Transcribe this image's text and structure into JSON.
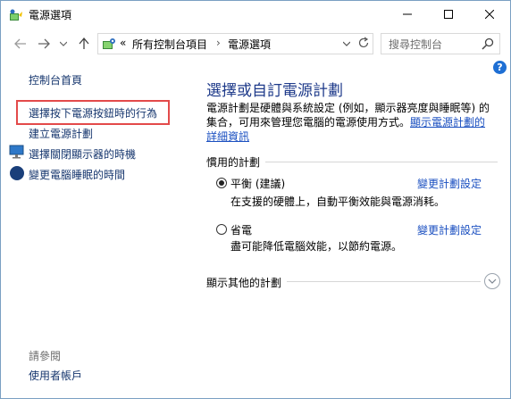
{
  "window": {
    "title": "電源選項",
    "minimize": "—",
    "maximize": "☐",
    "close": "✕"
  },
  "address": {
    "chevron": "«",
    "crumb1": "所有控制台項目",
    "sep": "›",
    "crumb2": "電源選項",
    "search_placeholder": "搜尋控制台"
  },
  "help": "?",
  "sidebar": {
    "items": [
      {
        "label": "控制台首頁"
      },
      {
        "label": "選擇按下電源按鈕時的行為"
      },
      {
        "label": "建立電源計劃"
      },
      {
        "label": "選擇關閉顯示器的時機"
      },
      {
        "label": "變更電腦睡眠的時間"
      }
    ],
    "see_also": "請參閱",
    "user_accounts": "使用者帳戶"
  },
  "main": {
    "heading": "選擇或自訂電源計劃",
    "description": "電源計劃是硬體與系統設定 (例如，顯示器亮度與睡眠等) 的集合，可用來管理您電腦的電源使用方式。",
    "more_link": "顯示電源計劃的詳細資訊",
    "preferred_section": "慣用的計劃",
    "plans": [
      {
        "name": "平衡 (建議)",
        "desc": "在支援的硬體上，自動平衡效能與電源消耗。",
        "change": "變更計劃設定",
        "selected": true
      },
      {
        "name": "省電",
        "desc": "盡可能降低電腦效能，以節約電源。",
        "change": "變更計劃設定",
        "selected": false
      }
    ],
    "other_section": "顯示其他的計劃"
  }
}
